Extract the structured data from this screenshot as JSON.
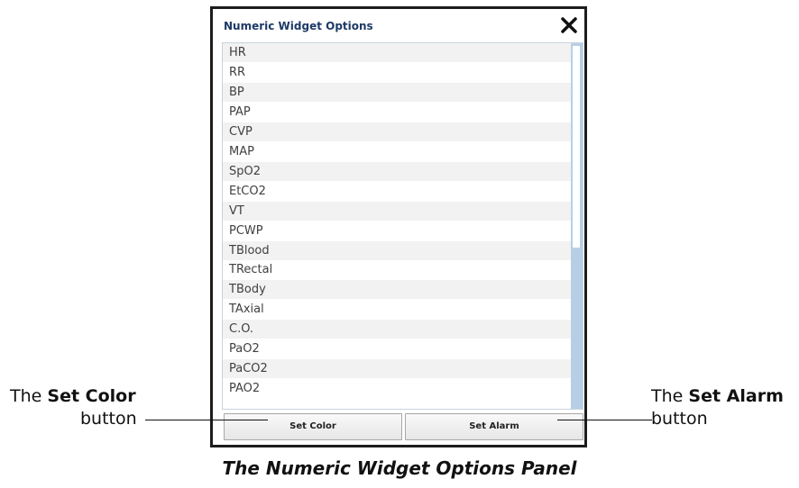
{
  "panel": {
    "title": "Numeric Widget Options",
    "close_icon": "close-icon",
    "items": [
      "HR",
      "RR",
      "BP",
      "PAP",
      "CVP",
      "MAP",
      "SpO2",
      "EtCO2",
      "VT",
      "PCWP",
      "TBlood",
      "TRectal",
      "TBody",
      "TAxial",
      "C.O.",
      "PaO2",
      "PaCO2",
      "PAO2"
    ],
    "buttons": {
      "set_color": "Set Color",
      "set_alarm": "Set Alarm"
    }
  },
  "callouts": {
    "left": {
      "prefix": "The",
      "bold": "Set Color",
      "suffix": "button"
    },
    "right": {
      "prefix": "The",
      "bold": "Set Alarm",
      "suffix": "button"
    }
  },
  "caption": "The Numeric Widget Options Panel",
  "colors": {
    "title": "#1d3a66",
    "scrollbar_track": "#b7cfe4",
    "row_alt": "#f2f2f2"
  }
}
